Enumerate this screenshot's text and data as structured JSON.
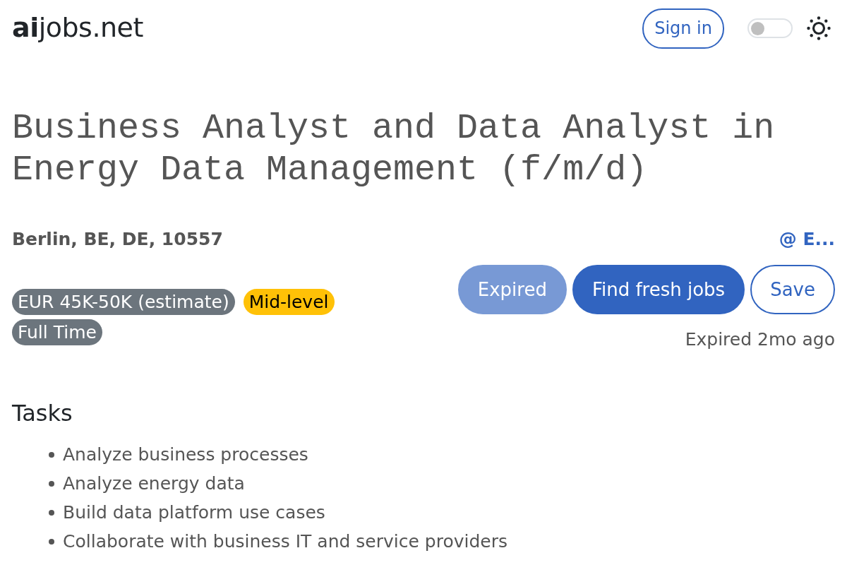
{
  "header": {
    "logo": "**ai**jobs.net",
    "sign_in": "Sign in",
    "theme_toggle": {
      "on": false
    }
  },
  "job": {
    "title": "Business Analyst and Data Analyst in Energy Data Management (f/m/d)",
    "location": "Berlin, BE, DE, 10557",
    "company": "@ E...",
    "tags": [
      {
        "label": "EUR 45K-50K (estimate)",
        "kind": "salary"
      },
      {
        "label": "Mid-level",
        "kind": "level"
      },
      {
        "label": "Full Time",
        "kind": "type"
      }
    ],
    "actions": [
      {
        "label": "Expired",
        "kind": "primary",
        "disabled": true
      },
      {
        "label": "Find fresh jobs",
        "kind": "primary",
        "disabled": false
      },
      {
        "label": "Save",
        "kind": "outline",
        "disabled": false
      }
    ],
    "expired_note": "Expired 2mo ago"
  },
  "sections": [
    {
      "heading": "Tasks",
      "items": [
        "Analyze business processes",
        "Analyze energy data",
        "Build data platform use cases",
        "Collaborate with business IT and service providers"
      ]
    }
  ]
}
